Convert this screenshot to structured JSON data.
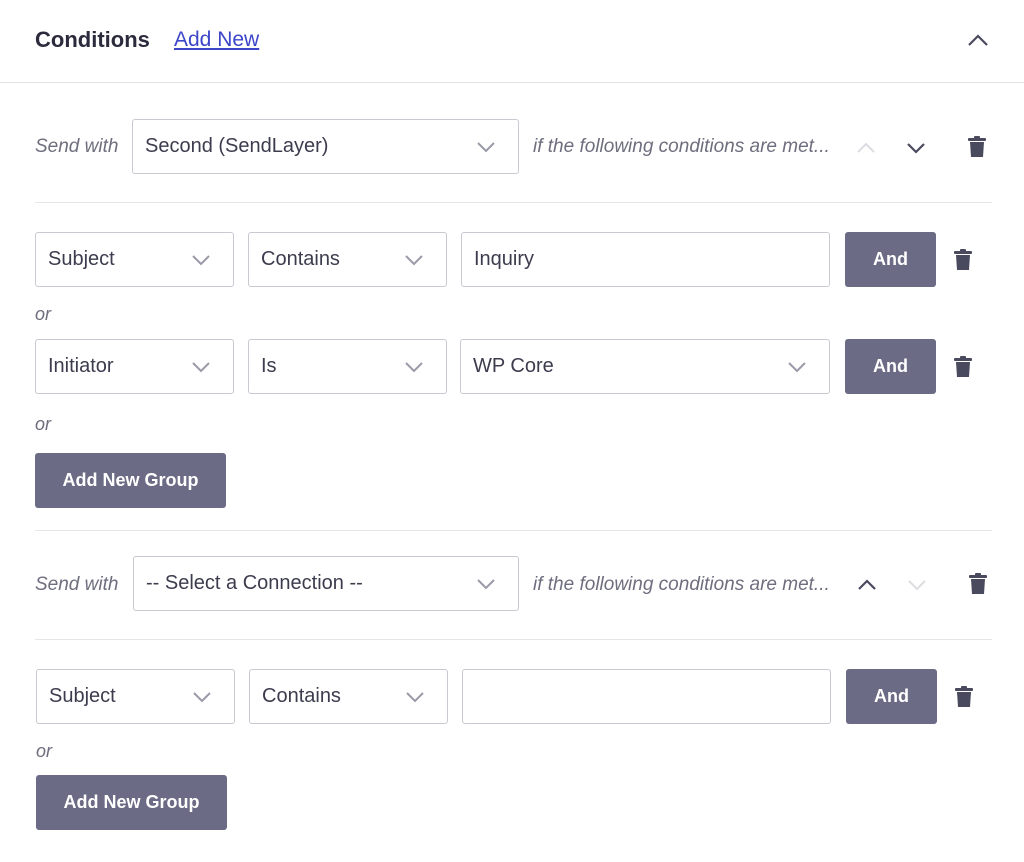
{
  "header": {
    "title": "Conditions",
    "add_new_label": "Add New",
    "collapse_icon": "chevron-up-icon"
  },
  "colors": {
    "button_bg": "#6b6b85",
    "link": "#3d45c9",
    "title": "#2b2b3d"
  },
  "rules": [
    {
      "send_with_label": "Send with",
      "connection": "Second (SendLayer)",
      "conditions_text": "if the following conditions are met...",
      "move_up_enabled": false,
      "move_down_enabled": true,
      "conditions": [
        {
          "field": "Subject",
          "operator": "Contains",
          "value": "Inquiry",
          "value_is_select": false,
          "and_label": "And"
        },
        {
          "field": "Initiator",
          "operator": "Is",
          "value": "WP Core",
          "value_is_select": true,
          "and_label": "And"
        }
      ],
      "or_label": "or",
      "add_group_label": "Add New Group"
    },
    {
      "send_with_label": "Send with",
      "connection": "-- Select a Connection --",
      "conditions_text": "if the following conditions are met...",
      "move_up_enabled": true,
      "move_down_enabled": false,
      "conditions": [
        {
          "field": "Subject",
          "operator": "Contains",
          "value": "",
          "value_is_select": false,
          "and_label": "And"
        }
      ],
      "or_label": "or",
      "add_group_label": "Add New Group"
    }
  ]
}
